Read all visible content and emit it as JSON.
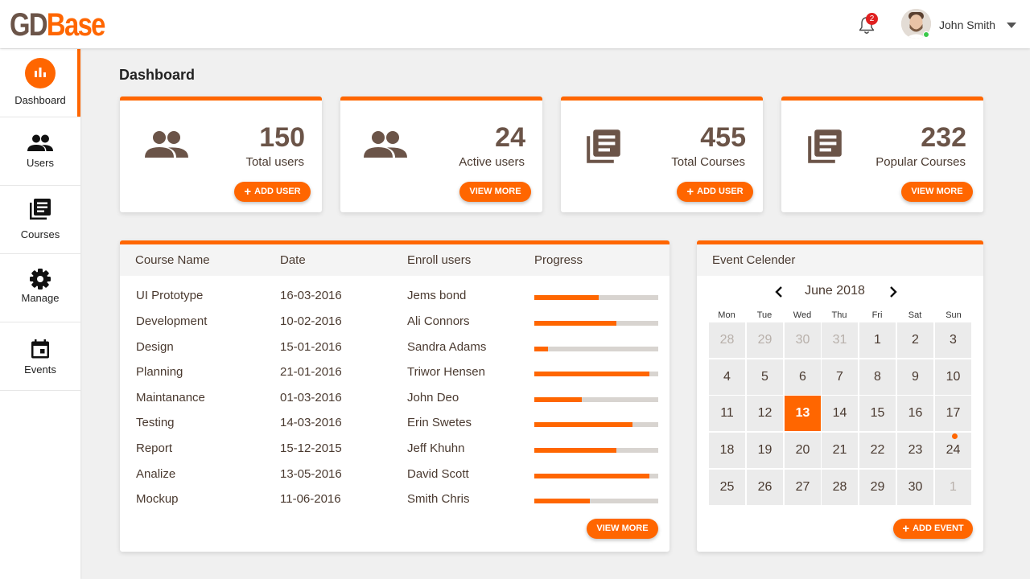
{
  "header": {
    "logo_part1": "GD",
    "logo_part2": "Base",
    "notification_count": "2",
    "user_name": "John Smith"
  },
  "sidebar": {
    "items": [
      {
        "label": "Dashboard",
        "icon": "bar-chart-icon",
        "active": true
      },
      {
        "label": "Users",
        "icon": "users-icon",
        "active": false
      },
      {
        "label": "Courses",
        "icon": "courses-icon",
        "active": false
      },
      {
        "label": "Manage",
        "icon": "gear-icon",
        "active": false
      },
      {
        "label": "Events",
        "icon": "calendar-icon",
        "active": false
      }
    ]
  },
  "page_title": "Dashboard",
  "stats": [
    {
      "value": "150",
      "label": "Total users",
      "icon": "users-icon",
      "button": "ADD USER"
    },
    {
      "value": "24",
      "label": "Active users",
      "icon": "users-icon",
      "button": "VIEW MORE"
    },
    {
      "value": "455",
      "label": "Total Courses",
      "icon": "courses-icon",
      "button": "ADD USER"
    },
    {
      "value": "232",
      "label": "Popular Courses",
      "icon": "courses-icon",
      "button": "VIEW MORE"
    }
  ],
  "courses_table": {
    "columns": [
      "Course Name",
      "Date",
      "Enroll users",
      "Progress"
    ],
    "rows": [
      {
        "name": "UI Prototype",
        "date": "16-03-2016",
        "user": "Jems bond",
        "progress": 52
      },
      {
        "name": "Development",
        "date": "10-02-2016",
        "user": "Ali Connors",
        "progress": 66
      },
      {
        "name": "Design",
        "date": "15-01-2016",
        "user": "Sandra Adams",
        "progress": 11
      },
      {
        "name": "Planning",
        "date": "21-01-2016",
        "user": "Triwor Hensen",
        "progress": 93
      },
      {
        "name": "Maintanance",
        "date": "01-03-2016",
        "user": "John Deo",
        "progress": 38
      },
      {
        "name": "Testing",
        "date": "14-03-2016",
        "user": "Erin Swetes",
        "progress": 79
      },
      {
        "name": "Report",
        "date": "15-12-2015",
        "user": "Jeff Khuhn",
        "progress": 66
      },
      {
        "name": "Analize",
        "date": "13-05-2016",
        "user": "David Scott",
        "progress": 93
      },
      {
        "name": "Mockup",
        "date": "11-06-2016",
        "user": "Smith Chris",
        "progress": 45
      }
    ],
    "button": "VIEW MORE"
  },
  "calendar": {
    "title": "Event Celender",
    "month": "June 2018",
    "weekdays": [
      "Mon",
      "Tue",
      "Wed",
      "Thu",
      "Fri",
      "Sat",
      "Sun"
    ],
    "days": [
      {
        "d": "28",
        "other": true
      },
      {
        "d": "29",
        "other": true
      },
      {
        "d": "30",
        "other": true
      },
      {
        "d": "31",
        "other": true
      },
      {
        "d": "1"
      },
      {
        "d": "2"
      },
      {
        "d": "3"
      },
      {
        "d": "4"
      },
      {
        "d": "5"
      },
      {
        "d": "6"
      },
      {
        "d": "7"
      },
      {
        "d": "8"
      },
      {
        "d": "9"
      },
      {
        "d": "10"
      },
      {
        "d": "11"
      },
      {
        "d": "12"
      },
      {
        "d": "13",
        "today": true
      },
      {
        "d": "14"
      },
      {
        "d": "15"
      },
      {
        "d": "16"
      },
      {
        "d": "17"
      },
      {
        "d": "18"
      },
      {
        "d": "19"
      },
      {
        "d": "20"
      },
      {
        "d": "21"
      },
      {
        "d": "22"
      },
      {
        "d": "23"
      },
      {
        "d": "24",
        "event": true
      },
      {
        "d": "25"
      },
      {
        "d": "26"
      },
      {
        "d": "27"
      },
      {
        "d": "28"
      },
      {
        "d": "29"
      },
      {
        "d": "30"
      },
      {
        "d": "1",
        "other": true
      }
    ],
    "button": "ADD EVENT"
  },
  "colors": {
    "accent": "#ff6600",
    "brown": "#6b5448"
  }
}
